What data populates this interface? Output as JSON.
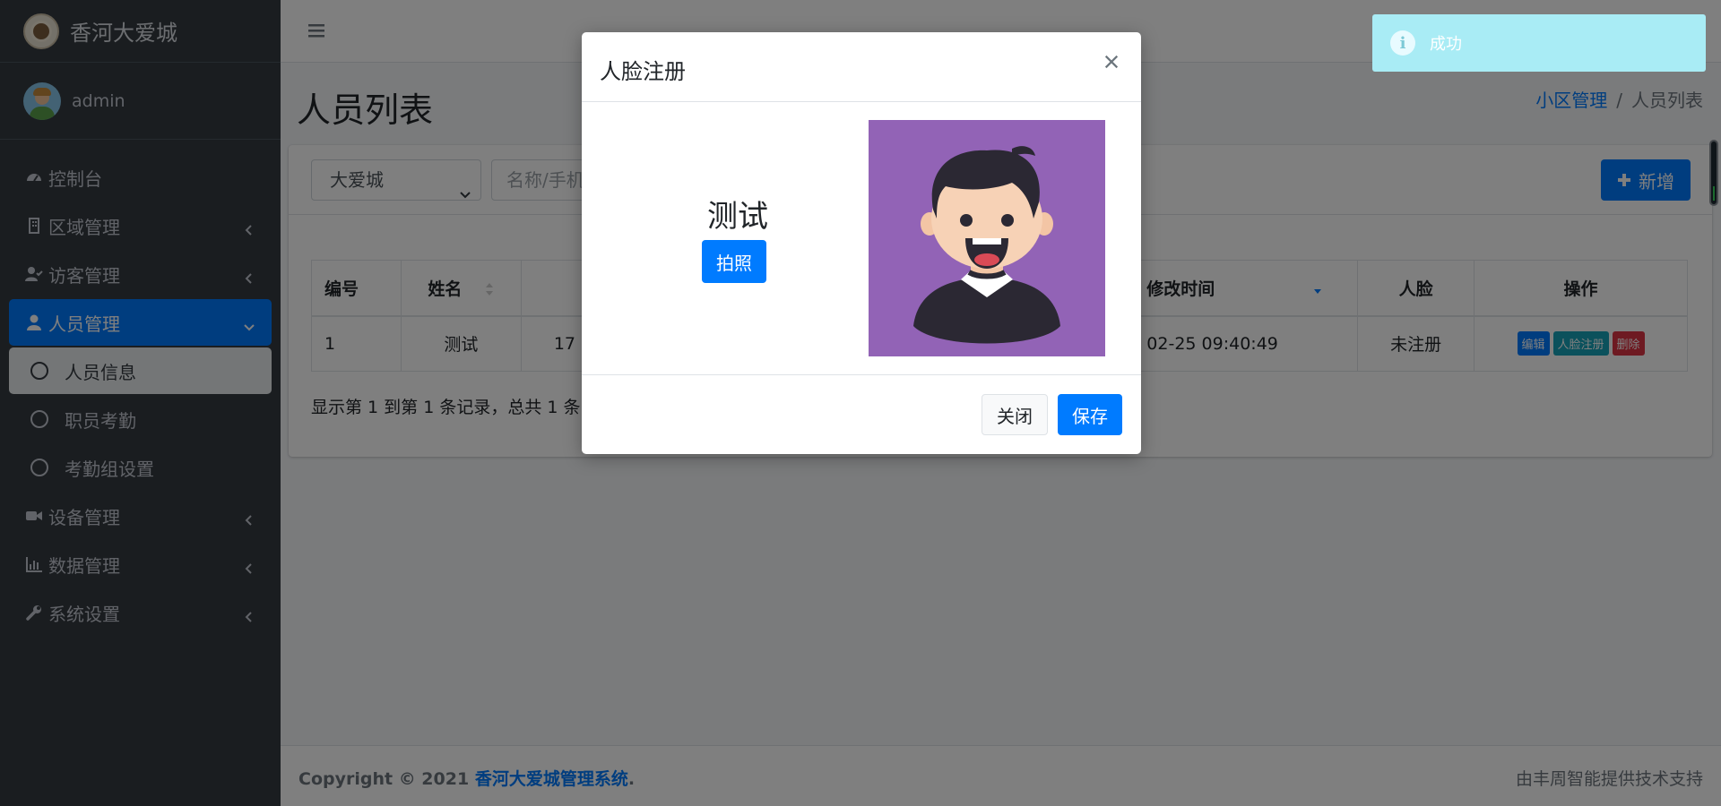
{
  "brand": {
    "name": "香河大爱城"
  },
  "user": {
    "name": "admin"
  },
  "sidebar": {
    "items": [
      {
        "label": "控制台"
      },
      {
        "label": "区域管理"
      },
      {
        "label": "访客管理"
      },
      {
        "label": "人员管理"
      },
      {
        "label": "人员信息"
      },
      {
        "label": "职员考勤"
      },
      {
        "label": "考勤组设置"
      },
      {
        "label": "设备管理"
      },
      {
        "label": "数据管理"
      },
      {
        "label": "系统设置"
      }
    ]
  },
  "header": {
    "title": "人员列表",
    "breadcrumb": {
      "parent": "小区管理",
      "sep": "/",
      "current": "人员列表"
    }
  },
  "toolbar": {
    "community_select": "大爱城",
    "search_placeholder": "名称/手机",
    "add_label": "新增"
  },
  "table": {
    "headers": [
      "编号",
      "姓名",
      "修改时间",
      "人脸",
      "操作"
    ],
    "rows": [
      {
        "id": "1",
        "name": "测试",
        "phone_partial": "17",
        "modified": "02-25 09:40:49",
        "face": "未注册"
      }
    ],
    "ops": {
      "edit": "编辑",
      "face": "人脸注册",
      "delete": "删除"
    }
  },
  "pagination": {
    "info": "显示第 1 到第 1 条记录，总共 1 条"
  },
  "footer": {
    "copyright_prefix": "Copyright © 2021",
    "copyright_link": "香河大爱城管理系统",
    "copyright_suffix": ".",
    "support": "由丰周智能提供技术支持"
  },
  "toast": {
    "text": "成功",
    "icon": "i"
  },
  "modal": {
    "title": "人脸注册",
    "close_glyph": "×",
    "person_name": "测试",
    "photo_label": "拍照",
    "close_label": "关闭",
    "save_label": "保存"
  },
  "colors": {
    "primary": "#007bff",
    "sidebar_bg": "#343a40",
    "info": "#17a2b8",
    "danger": "#dc3545",
    "face_bg": "#9263b6"
  }
}
